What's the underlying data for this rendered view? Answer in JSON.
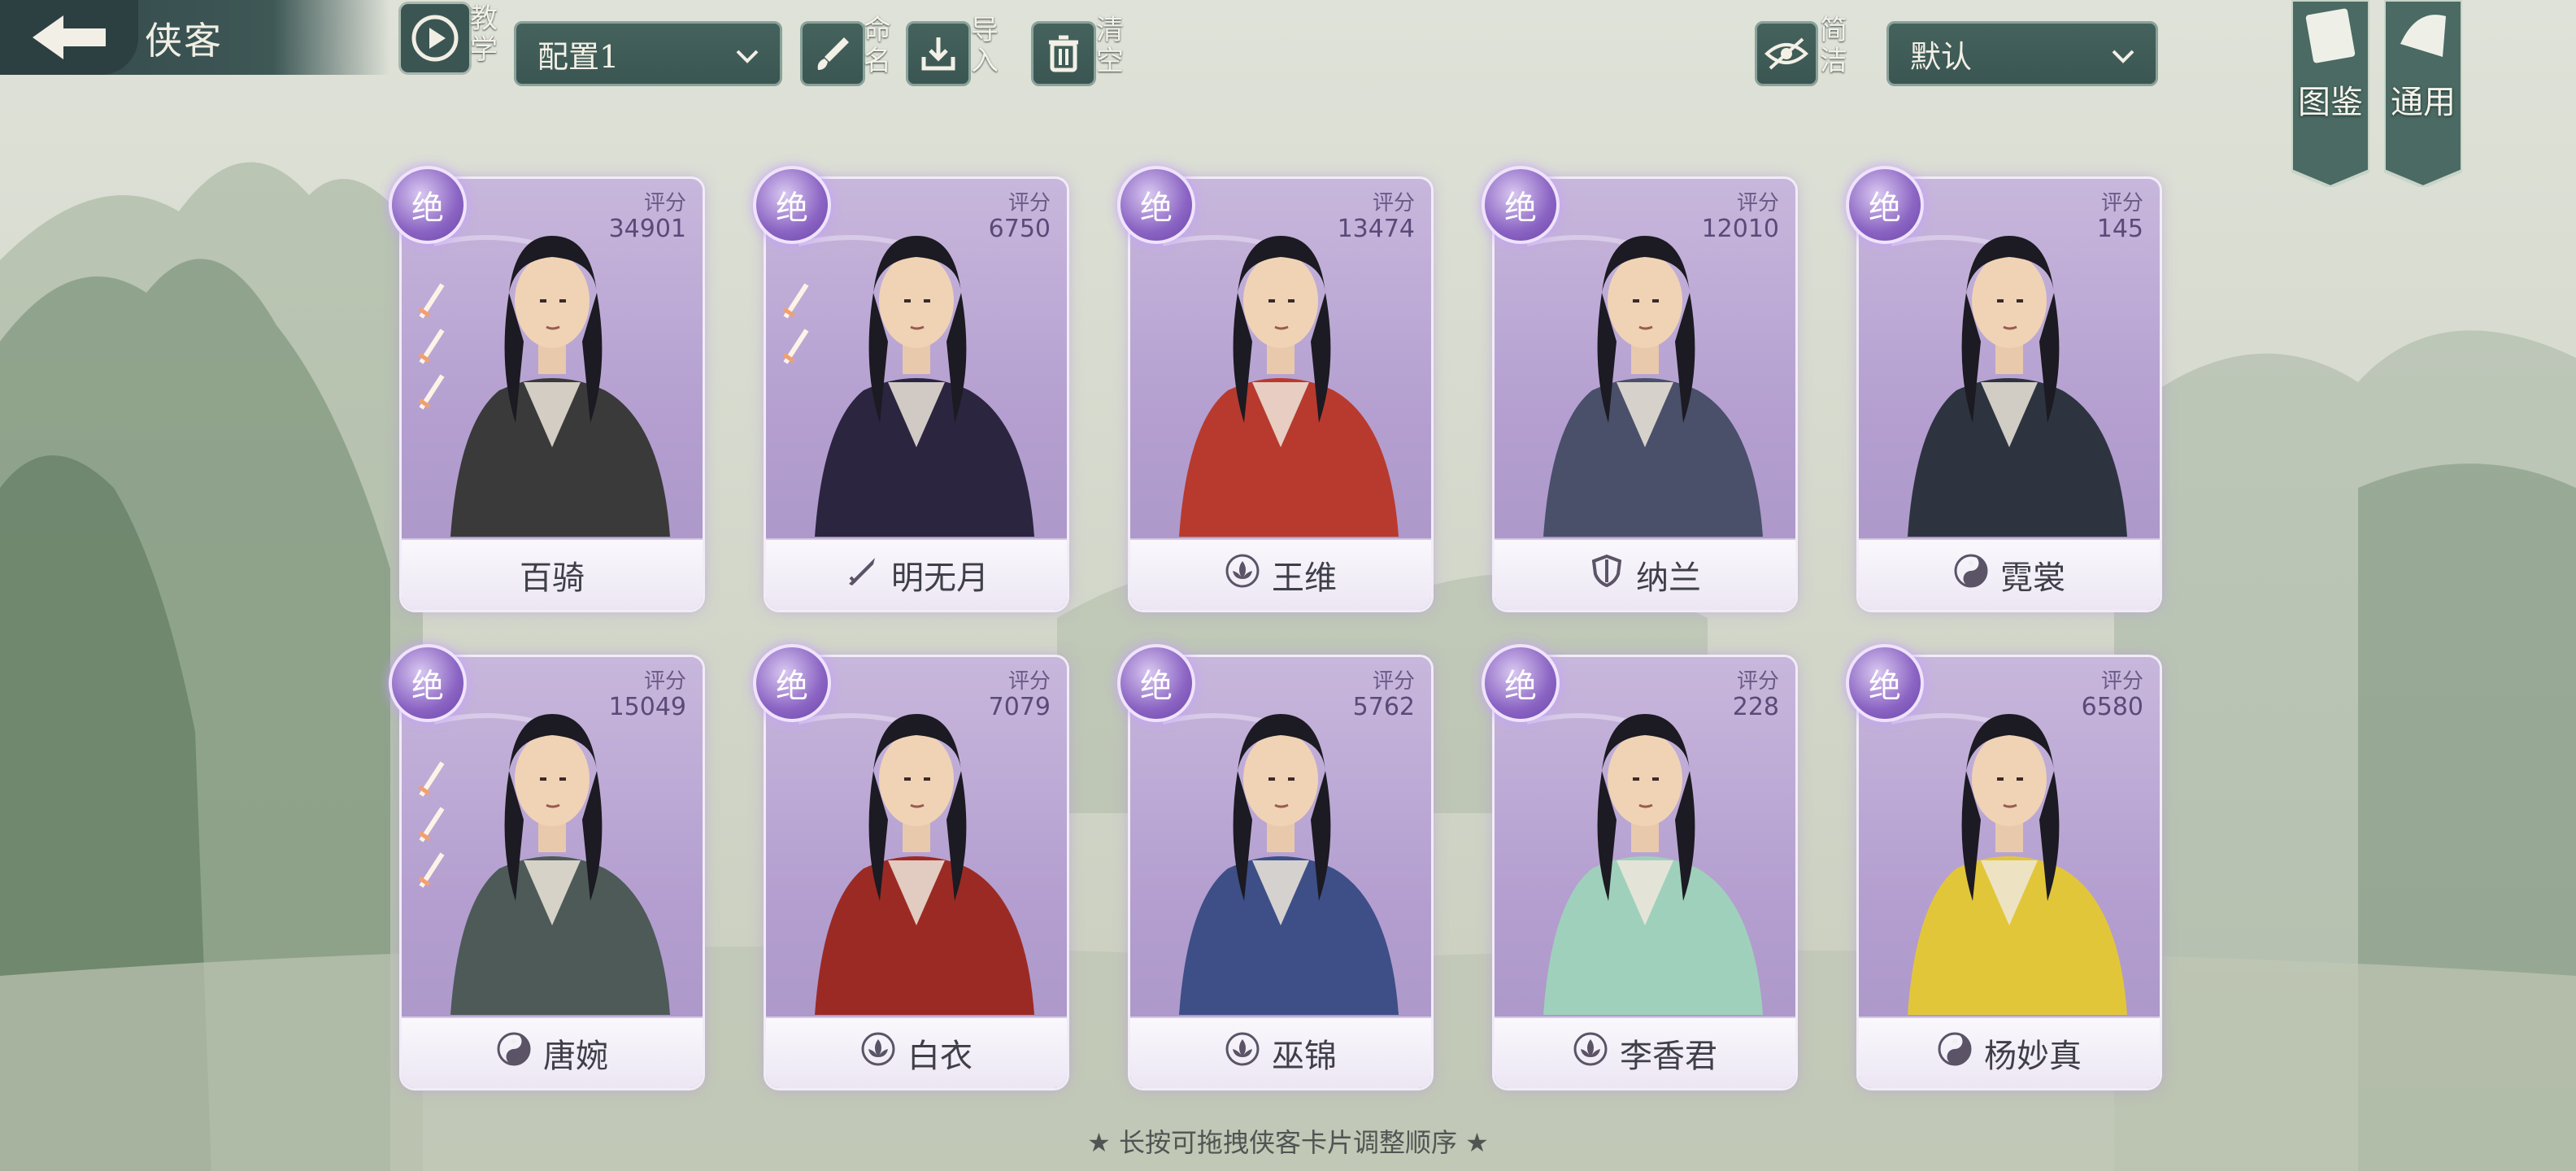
{
  "header": {
    "title": "侠客",
    "teach_label": "教学",
    "config_select": "配置1",
    "rename_label": "命名",
    "import_label": "导入",
    "clear_label": "清空",
    "simple_label": "简洁",
    "sort_select": "默认",
    "gallery_label": "图鉴",
    "general_label": "通用"
  },
  "score_label": "评分",
  "rank_label": "绝",
  "cards": [
    {
      "name": "百骑",
      "score": "34901",
      "sect_icon": "",
      "swords": 3,
      "palette": "#3a3a3a"
    },
    {
      "name": "明无月",
      "score": "6750",
      "sect_icon": "blade-icon",
      "swords": 2,
      "palette": "#2b2540"
    },
    {
      "name": "王维",
      "score": "13474",
      "sect_icon": "lotus-icon",
      "swords": 0,
      "palette": "#b83a2e"
    },
    {
      "name": "纳兰",
      "score": "12010",
      "sect_icon": "shield-icon",
      "swords": 0,
      "palette": "#4a4f6a"
    },
    {
      "name": "霓裳",
      "score": "145",
      "sect_icon": "yinyang-icon",
      "swords": 0,
      "palette": "#2d3440"
    },
    {
      "name": "唐婉",
      "score": "15049",
      "sect_icon": "yinyang-icon",
      "swords": 3,
      "palette": "#4d5a58"
    },
    {
      "name": "白衣",
      "score": "7079",
      "sect_icon": "lotus-icon",
      "swords": 0,
      "palette": "#9c2a24"
    },
    {
      "name": "巫锦",
      "score": "5762",
      "sect_icon": "lotus-icon",
      "swords": 0,
      "palette": "#3d4f86"
    },
    {
      "name": "李香君",
      "score": "228",
      "sect_icon": "lotus-icon",
      "swords": 0,
      "palette": "#9fd0bb"
    },
    {
      "name": "杨妙真",
      "score": "6580",
      "sect_icon": "yinyang-icon",
      "swords": 0,
      "palette": "#e2c63a"
    }
  ],
  "hint": "★ 长按可拖拽侠客卡片调整顺序 ★",
  "colors": {
    "panel": "#3b5652",
    "card_purple": "#b49fd0",
    "rank_purple": "#8a63c3"
  }
}
